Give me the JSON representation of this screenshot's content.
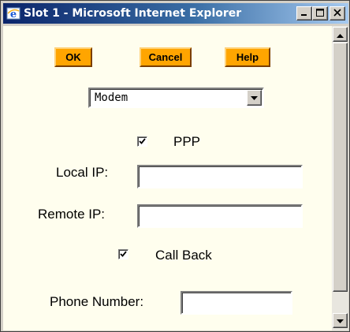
{
  "window": {
    "title": "Slot 1 - Microsoft Internet Explorer",
    "icon": "internet-explorer-icon",
    "controls": [
      "minimize-icon",
      "maximize-icon",
      "close-icon"
    ]
  },
  "buttons": {
    "ok_label": "OK",
    "cancel_label": "Cancel",
    "help_label": "Help"
  },
  "mode_select": {
    "value": "Modem"
  },
  "ppp": {
    "label": "PPP",
    "checked": true
  },
  "local_ip": {
    "label": "Local IP:",
    "value": ""
  },
  "remote_ip": {
    "label": "Remote IP:",
    "value": ""
  },
  "call_back": {
    "label": "Call Back",
    "checked": true
  },
  "phone_number": {
    "label": "Phone Number:",
    "value": ""
  },
  "colors": {
    "content_bg": "#fffeee",
    "button_bg": "#ffa500",
    "titlebar_start": "#0a246a",
    "titlebar_end": "#a6caf0"
  }
}
